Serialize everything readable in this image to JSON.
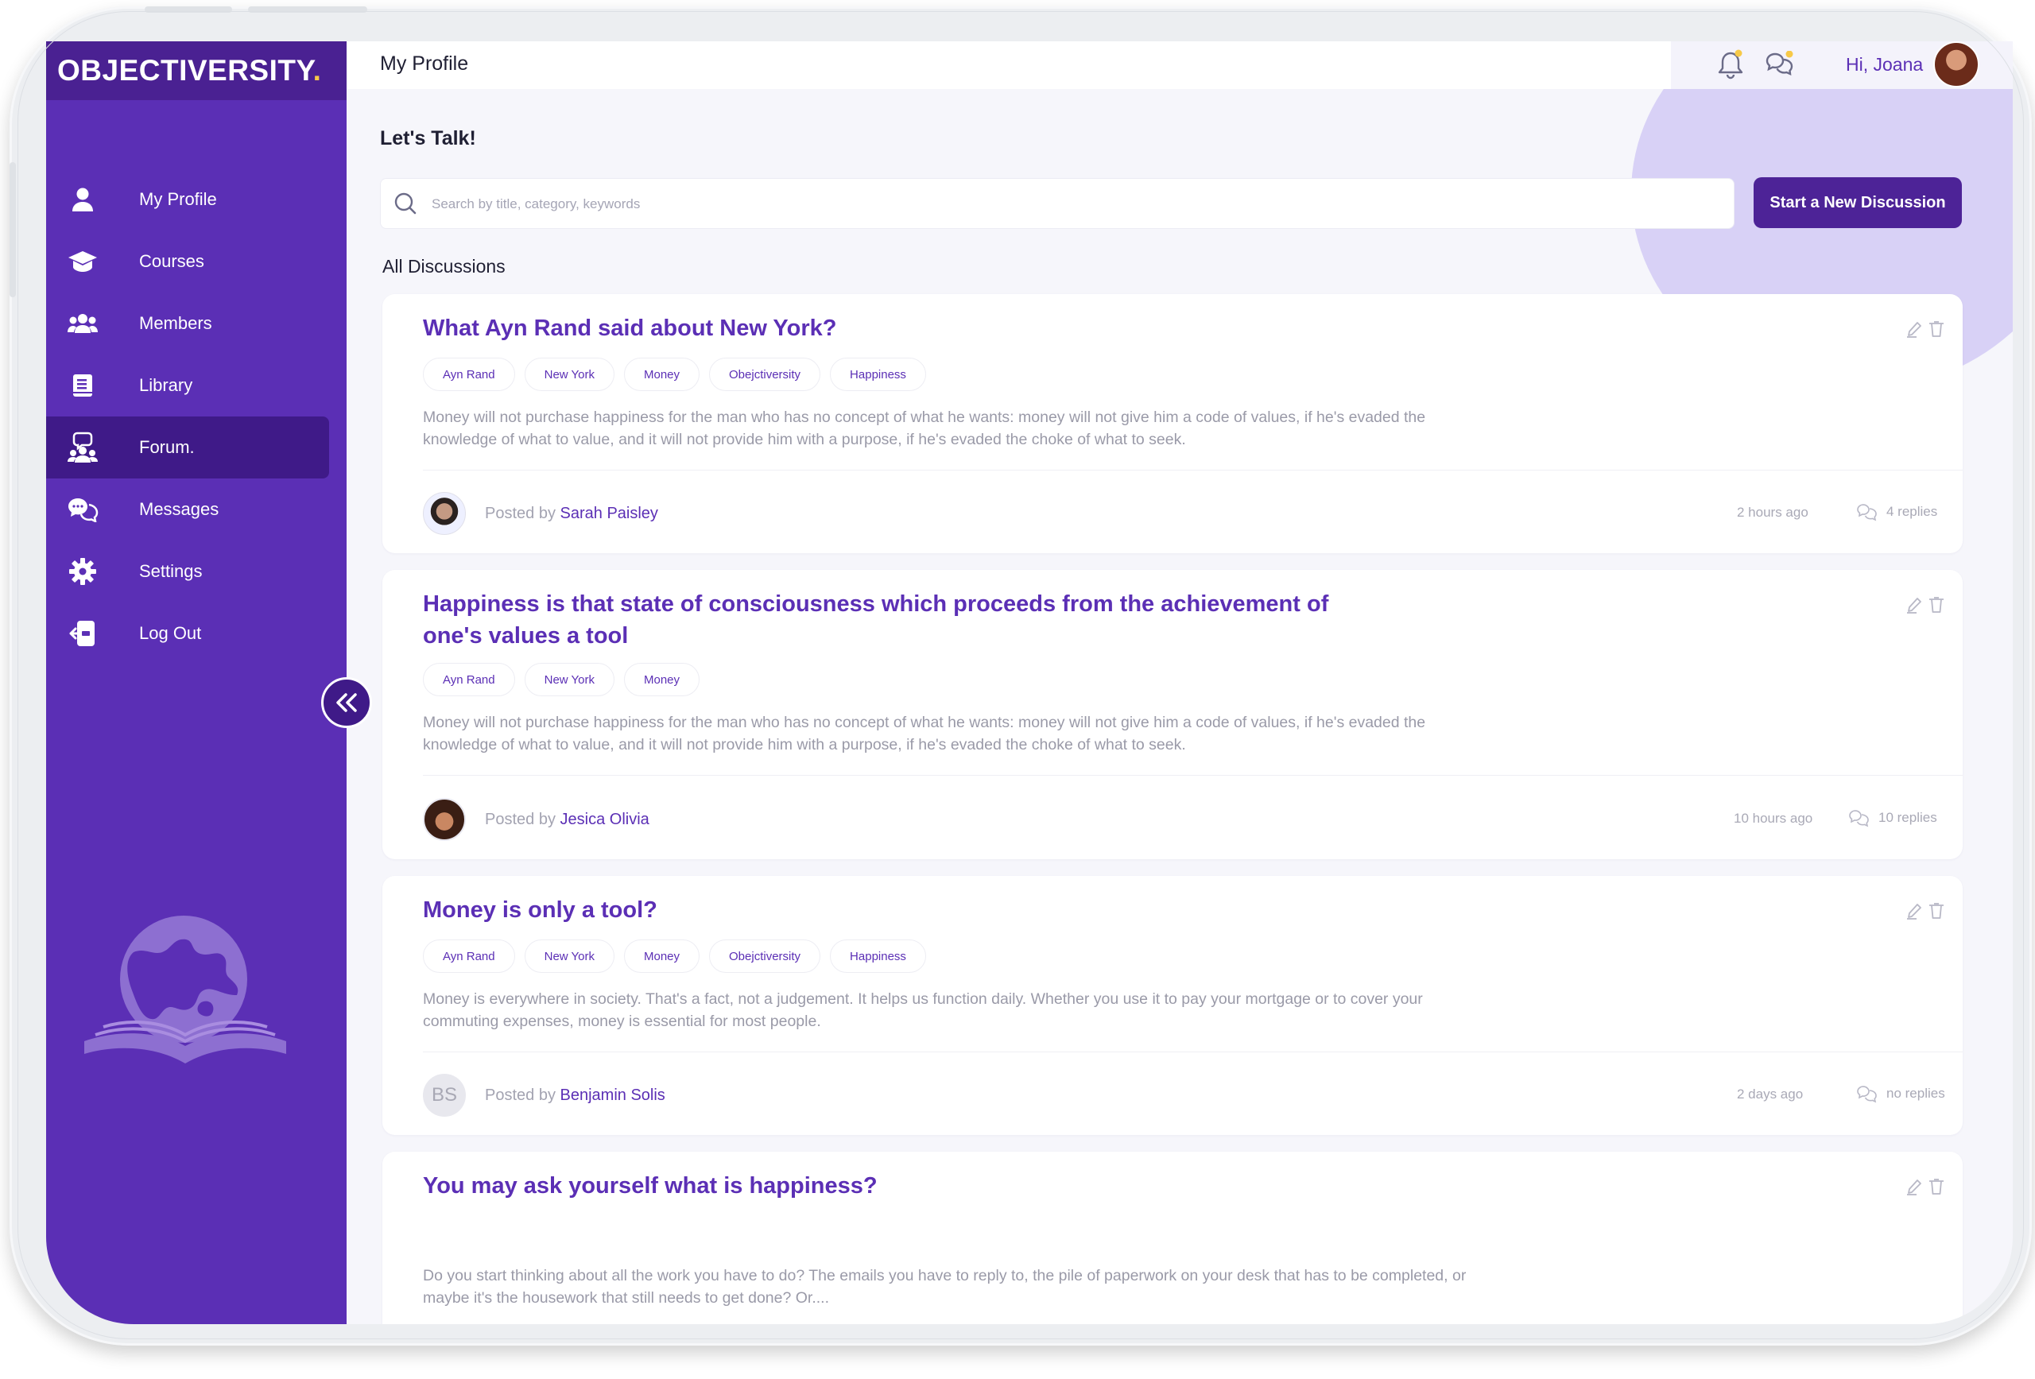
{
  "brand": {
    "name": "OBJECTIVERSITY",
    "dot": ".",
    "accent": "#f7c948",
    "sidebar_color": "#5b2fb5"
  },
  "sidebar": {
    "items": [
      {
        "label": "My Profile",
        "icon": "user-icon"
      },
      {
        "label": "Courses",
        "icon": "graduation-cap-icon"
      },
      {
        "label": "Members",
        "icon": "members-icon"
      },
      {
        "label": "Library",
        "icon": "book-icon"
      },
      {
        "label": "Forum.",
        "icon": "forum-icon",
        "active": true
      },
      {
        "label": "Messages",
        "icon": "chat-bubbles-icon"
      },
      {
        "label": "Settings",
        "icon": "gear-icon"
      },
      {
        "label": "Log Out",
        "icon": "logout-icon"
      }
    ]
  },
  "header": {
    "title": "My Profile",
    "greeting": "Hi, Joana"
  },
  "forum": {
    "heading": "Let's Talk!",
    "search_placeholder": "Search by title, category, keywords",
    "new_button": "Start a New Discussion",
    "section_label": "All Discussions"
  },
  "discussions": [
    {
      "title": "What Ayn Rand said about New York?",
      "tags": [
        "Ayn Rand",
        "New York",
        "Money",
        "Obejctiversity",
        "Happiness"
      ],
      "excerpt": "Money will not purchase happiness for the man who has no concept of what he wants: money will not give him a code of values, if he's evaded the knowledge of what to value, and it will not provide him with a purpose, if he's evaded the choke of what to seek.",
      "posted_by": "Posted by",
      "author": "Sarah Paisley",
      "time": "2 hours ago",
      "replies": "4 replies"
    },
    {
      "title": "Happiness is that state of consciousness which proceeds from the achievement of one's values a tool",
      "tags": [
        "Ayn Rand",
        "New York",
        "Money"
      ],
      "excerpt": "Money will not purchase happiness for the man who has no concept of what he wants: money will not give him a code of values, if he's evaded the knowledge of what to value, and it will not provide him with a purpose, if he's evaded the choke of what to seek.",
      "posted_by": "Posted by",
      "author": "Jesica Olivia",
      "time": "10 hours ago",
      "replies": "10 replies"
    },
    {
      "title": "Money is only a tool?",
      "tags": [
        "Ayn Rand",
        "New York",
        "Money",
        "Obejctiversity",
        "Happiness"
      ],
      "excerpt": "Money is everywhere in society. That's a fact, not a judgement. It helps us function daily. Whether you use it to pay your mortgage or to cover your commuting expenses, money is essential for most people.",
      "posted_by": "Posted by",
      "author": "Benjamin Solis",
      "initials": "BS",
      "time": "2 days ago",
      "replies": "no replies"
    },
    {
      "title": "You may ask yourself what is happiness?",
      "tags": [],
      "excerpt": "Do you start thinking about all the work you have to do? The emails you have to reply to, the pile of paperwork on your desk that has to be completed, or maybe it's the housework that still needs to get done? Or...."
    }
  ]
}
